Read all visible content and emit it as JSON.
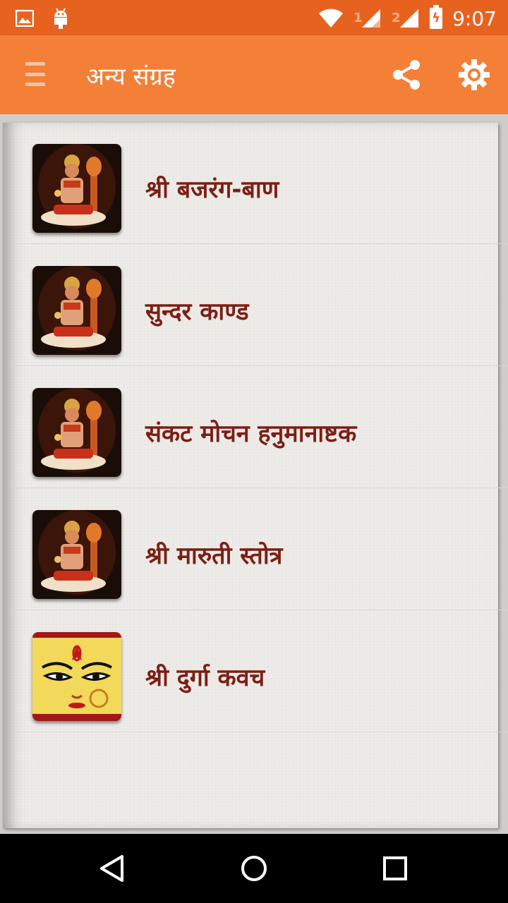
{
  "status_bar": {
    "time": "9:07",
    "sim1": "1",
    "sim2": "2",
    "icons": [
      "image-icon",
      "android-icon",
      "wifi-icon",
      "signal-icon",
      "signal-icon",
      "battery-charging-icon"
    ]
  },
  "toolbar": {
    "title": "अन्य संग्रह",
    "menu_icon": "menu-icon",
    "share_icon": "share-icon",
    "settings_icon": "gear-icon"
  },
  "list": {
    "items": [
      {
        "label": "श्री बजरंग-बाण",
        "thumb": "hanuman-image"
      },
      {
        "label": "सुन्दर काण्ड",
        "thumb": "hanuman-image"
      },
      {
        "label": "संकट मोचन हनुमानाष्टक",
        "thumb": "hanuman-image"
      },
      {
        "label": "श्री मारुती स्तोत्र",
        "thumb": "hanuman-image"
      },
      {
        "label": "श्री दुर्गा कवच",
        "thumb": "durga-image"
      }
    ]
  },
  "colors": {
    "status_bar": "#e8621f",
    "toolbar": "#f47f37",
    "item_text": "#7b1f15",
    "paper": "#eeece9"
  },
  "nav_bar": {
    "icons": [
      "back-icon",
      "home-icon",
      "recents-icon"
    ]
  }
}
